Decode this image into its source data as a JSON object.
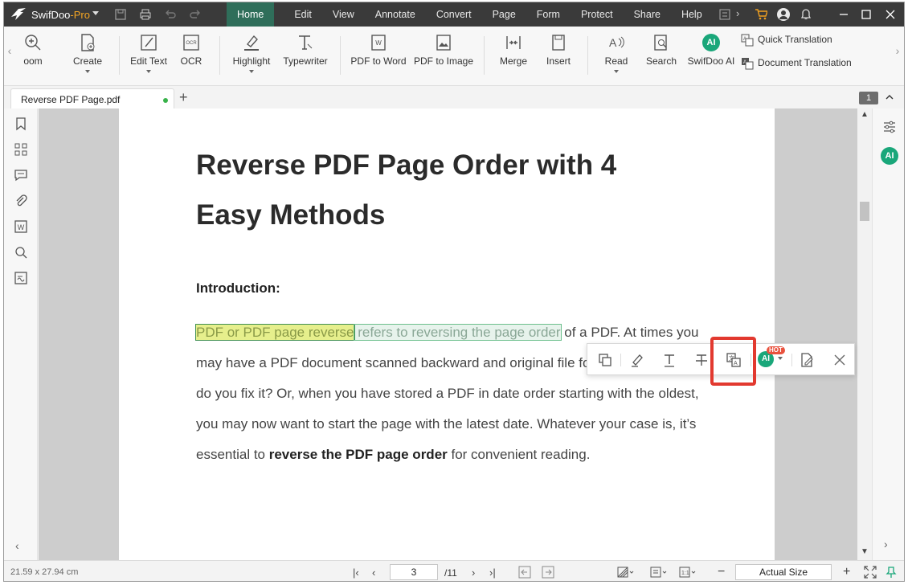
{
  "app": {
    "name": "SwifDoo",
    "edition": "-Pro"
  },
  "menu": [
    "Home",
    "Edit",
    "View",
    "Annotate",
    "Convert",
    "Page",
    "Form",
    "Protect",
    "Share",
    "Help"
  ],
  "ribbon": {
    "zoom": "oom",
    "create": "Create",
    "edit_text": "Edit Text",
    "ocr": "OCR",
    "highlight": "Highlight",
    "typewriter": "Typewriter",
    "pdf_to_word": "PDF to Word",
    "pdf_to_image": "PDF to Image",
    "merge": "Merge",
    "insert": "Insert",
    "read": "Read",
    "search": "Search",
    "swifdoo_ai": "SwifDoo AI",
    "quick_translation": "Quick Translation",
    "document_translation": "Document Translation"
  },
  "tab": {
    "filename": "Reverse PDF Page.pdf",
    "page_badge": "1"
  },
  "ai_label": "AI",
  "document": {
    "title": "Reverse PDF Page Order with 4 Easy Methods",
    "heading": "Introduction:",
    "hl1": "PDF or PDF page reverse",
    "hl2": " refers to reversing the page order",
    "p1": " of a PDF. At times you may have a PDF document scanned backward and original file for re-scanning, how do you fix it? Or, when you have stored a PDF in date order starting with the oldest, you may now want to start the page with the latest date. Whatever your case is, it’s essential to ",
    "bold1": "reverse the PDF page order",
    "p2": " for convenient reading."
  },
  "float_toolbar": {
    "hot_badge": "HOT"
  },
  "status": {
    "dimensions": "21.59 x 27.94 cm",
    "current_page": "3",
    "total_pages": "/11",
    "zoom": "Actual Size"
  }
}
